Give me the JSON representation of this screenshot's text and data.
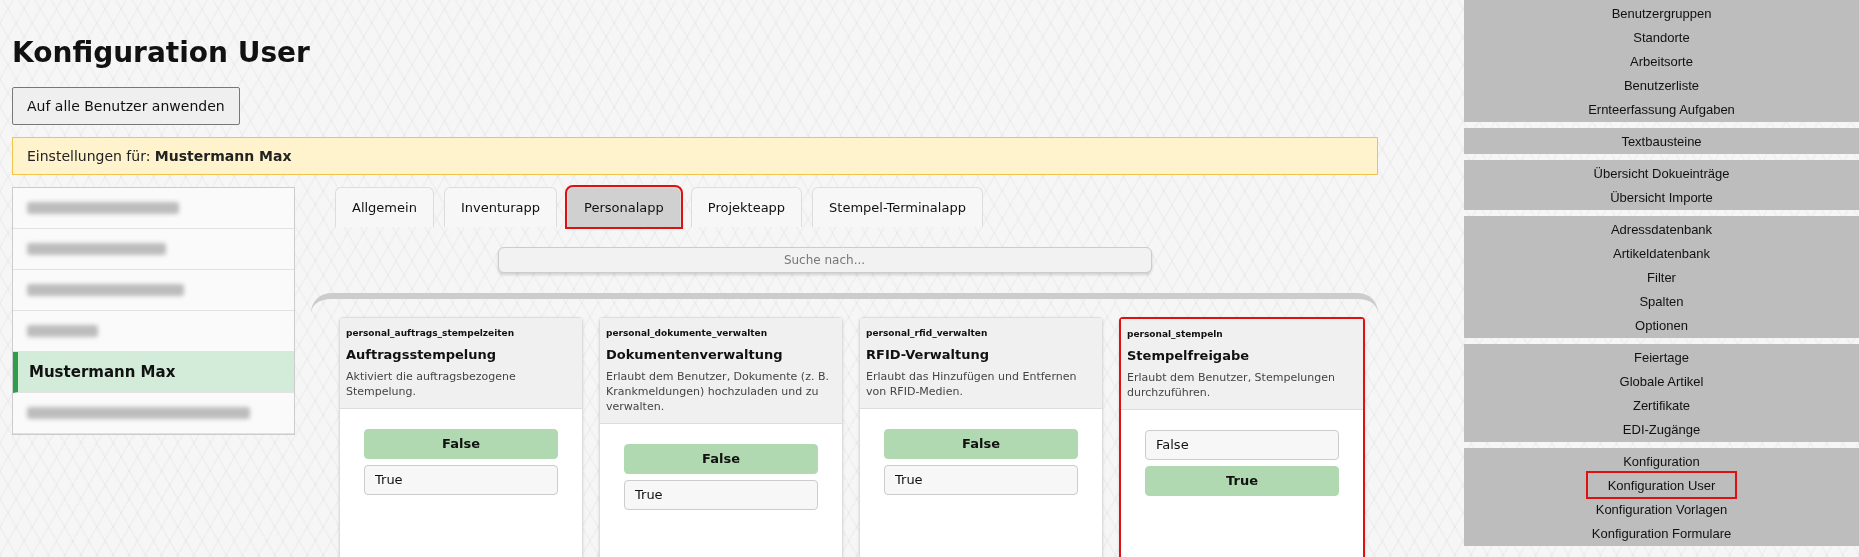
{
  "page": {
    "title": "Konfiguration User"
  },
  "apply_button": "Auf alle Benutzer anwenden",
  "settings_banner": {
    "label": "Einstellungen für:",
    "user": "Mustermann Max"
  },
  "users": [
    {
      "kind": "redacted",
      "selected": false
    },
    {
      "kind": "redacted",
      "selected": false
    },
    {
      "kind": "redacted",
      "selected": false
    },
    {
      "kind": "redacted",
      "selected": false
    },
    {
      "kind": "named",
      "name": "Mustermann Max",
      "selected": true
    },
    {
      "kind": "redacted",
      "selected": false
    }
  ],
  "tabs": [
    {
      "label": "Allgemein",
      "selected": false,
      "highlighted": false
    },
    {
      "label": "Inventurapp",
      "selected": false,
      "highlighted": false
    },
    {
      "label": "Personalapp",
      "selected": true,
      "highlighted": true
    },
    {
      "label": "Projekteapp",
      "selected": false,
      "highlighted": false
    },
    {
      "label": "Stempel-Terminalapp",
      "selected": false,
      "highlighted": false
    }
  ],
  "search": {
    "placeholder": "Suche nach..."
  },
  "settings": [
    {
      "key": "personal_auftrags_stempelzeiten",
      "title": "Auftragsstempelung",
      "description": "Aktiviert die auftragsbezogene Stempelung.",
      "highlighted": false,
      "options": [
        {
          "label": "False",
          "selected": true
        },
        {
          "label": "True",
          "selected": false
        }
      ]
    },
    {
      "key": "personal_dokumente_verwalten",
      "title": "Dokumentenverwaltung",
      "description": "Erlaubt dem Benutzer, Dokumente (z. B. Krankmeldungen) hochzuladen und zu verwalten.",
      "highlighted": false,
      "options": [
        {
          "label": "False",
          "selected": true
        },
        {
          "label": "True",
          "selected": false
        }
      ]
    },
    {
      "key": "personal_rfid_verwalten",
      "title": "RFID-Verwaltung",
      "description": "Erlaubt das Hinzufügen und Entfernen von RFID-Medien.",
      "highlighted": false,
      "options": [
        {
          "label": "False",
          "selected": true
        },
        {
          "label": "True",
          "selected": false
        }
      ]
    },
    {
      "key": "personal_stempeln",
      "title": "Stempelfreigabe",
      "description": "Erlaubt dem Benutzer, Stempelungen durchzuführen.",
      "highlighted": true,
      "options": [
        {
          "label": "False",
          "selected": false
        },
        {
          "label": "True",
          "selected": true
        }
      ]
    }
  ],
  "sidebar": {
    "groups": [
      {
        "items": [
          {
            "label": "Benutzergruppen",
            "highlighted": false
          },
          {
            "label": "Standorte",
            "highlighted": false
          },
          {
            "label": "Arbeitsorte",
            "highlighted": false
          },
          {
            "label": "Benutzerliste",
            "highlighted": false
          },
          {
            "label": "Ernteerfassung Aufgaben",
            "highlighted": false
          }
        ]
      },
      {
        "items": [
          {
            "label": "Textbausteine",
            "highlighted": false
          }
        ]
      },
      {
        "items": [
          {
            "label": "Übersicht Dokueinträge",
            "highlighted": false
          },
          {
            "label": "Übersicht Importe",
            "highlighted": false
          }
        ]
      },
      {
        "items": [
          {
            "label": "Adressdatenbank",
            "highlighted": false
          },
          {
            "label": "Artikeldatenbank",
            "highlighted": false
          },
          {
            "label": "Filter",
            "highlighted": false
          },
          {
            "label": "Spalten",
            "highlighted": false
          },
          {
            "label": "Optionen",
            "highlighted": false
          }
        ]
      },
      {
        "items": [
          {
            "label": "Feiertage",
            "highlighted": false
          },
          {
            "label": "Globale Artikel",
            "highlighted": false
          },
          {
            "label": "Zertifikate",
            "highlighted": false
          },
          {
            "label": "EDI-Zugänge",
            "highlighted": false
          }
        ]
      },
      {
        "items": [
          {
            "label": "Konfiguration",
            "highlighted": false
          },
          {
            "label": "Konfiguration User",
            "highlighted": true
          },
          {
            "label": "Konfiguration Vorlagen",
            "highlighted": false
          },
          {
            "label": "Konfiguration Formulare",
            "highlighted": false
          }
        ]
      }
    ]
  }
}
